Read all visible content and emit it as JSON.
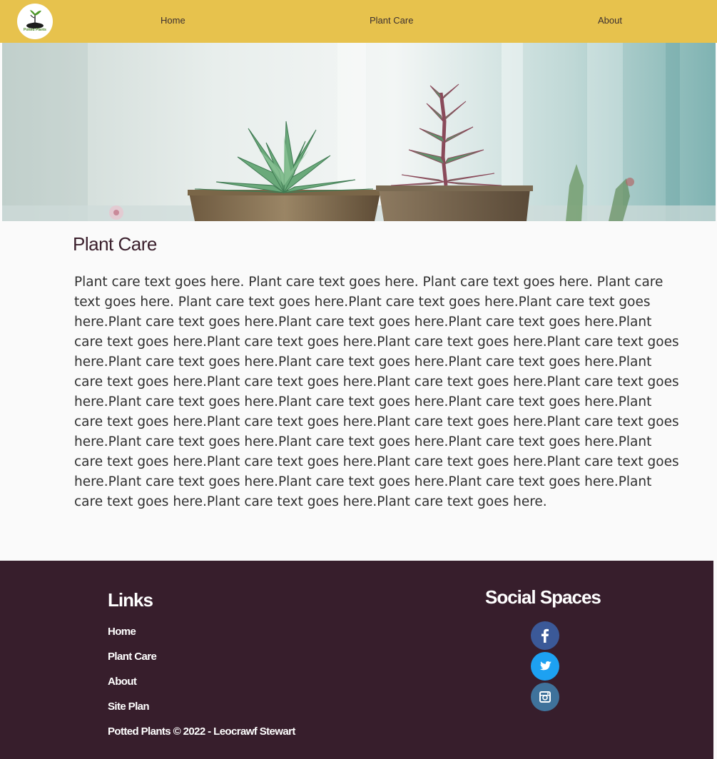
{
  "header": {
    "logo_text": "Potted Plants",
    "nav": [
      {
        "label": "Home"
      },
      {
        "label": "Plant Care"
      },
      {
        "label": "About"
      }
    ]
  },
  "main": {
    "title": "Plant Care",
    "body": "Plant care text goes here. Plant care text goes here. Plant care text goes here. Plant care text goes here. Plant care text goes here.Plant care text goes here.Plant care text goes here.Plant care text goes here.Plant care text goes here.Plant care text goes here.Plant care text goes here.Plant care text goes here.Plant care text goes here.Plant care text goes here.Plant care text goes here.Plant care text goes here.Plant care text goes here.Plant care text goes here.Plant care text goes here.Plant care text goes here.Plant care text goes here.Plant care text goes here.Plant care text goes here.Plant care text goes here.Plant care text goes here.Plant care text goes here.Plant care text goes here.Plant care text goes here.Plant care text goes here.Plant care text goes here.Plant care text goes here.Plant care text goes here.Plant care text goes here.Plant care text goes here.Plant care text goes here.Plant care text goes here.Plant care text goes here.Plant care text goes here.Plant care text goes here.Plant care text goes here.Plant care text goes here."
  },
  "footer": {
    "links_heading": "Links",
    "links": [
      {
        "label": "Home"
      },
      {
        "label": "Plant Care"
      },
      {
        "label": "About"
      },
      {
        "label": "Site Plan"
      }
    ],
    "copyright": "Potted Plants © 2022 - Leocrawf Stewart",
    "social_heading": "Social Spaces",
    "social": [
      {
        "icon": "facebook-icon",
        "color": "#3b5998"
      },
      {
        "icon": "twitter-icon",
        "color": "#1da1f2"
      },
      {
        "icon": "instagram-icon",
        "color": "#3f729b"
      }
    ]
  },
  "colors": {
    "header_bg": "#e7c24d",
    "footer_bg": "#371e2c",
    "page_bg": "#fafafa",
    "title": "#3a1f2c"
  }
}
